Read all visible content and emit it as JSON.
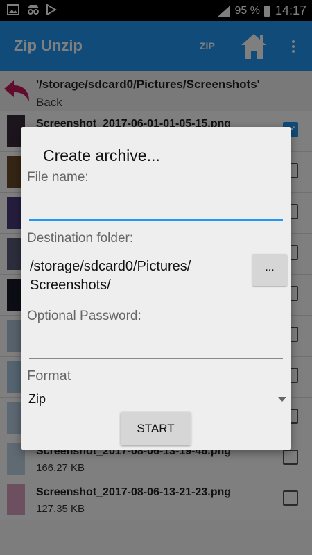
{
  "status_bar": {
    "battery_percent": "95 %",
    "time": "14:17",
    "icons": [
      "image-icon",
      "incognito-icon",
      "play-store-icon",
      "signal-icon",
      "battery-icon"
    ]
  },
  "app_bar": {
    "title": "Zip Unzip",
    "zip_label": "ZIP",
    "icons": [
      "home-icon",
      "more-vert-icon"
    ],
    "color": "#2196f3"
  },
  "path_row": {
    "path": "'/storage/sdcard0/Pictures/Screenshots'",
    "back_label": "Back"
  },
  "files": [
    {
      "name": "Screenshot_2017-06-01-01-05-15.png",
      "size": "",
      "checked": true
    },
    {
      "name": "",
      "size": "",
      "checked": false
    },
    {
      "name": "",
      "size": "",
      "checked": false
    },
    {
      "name": "",
      "size": "",
      "checked": false
    },
    {
      "name": "",
      "size": "",
      "checked": false
    },
    {
      "name": "",
      "size": "",
      "checked": false
    },
    {
      "name": "",
      "size": "",
      "checked": false
    },
    {
      "name": "",
      "size": "",
      "checked": false
    },
    {
      "name": "Screenshot_2017-08-06-13-19-46.png",
      "size": "166.27 KB",
      "checked": false
    },
    {
      "name": "Screenshot_2017-08-06-13-21-23.png",
      "size": "127.35 KB",
      "checked": false
    }
  ],
  "dialog": {
    "title": "Create archive...",
    "file_name_label": "File name:",
    "file_name_value": "",
    "destination_label": "Destination folder:",
    "destination_line1": "/storage/sdcard0/Pictures/",
    "destination_line2": "Screenshots/",
    "browse_button": "...",
    "password_label": "Optional Password:",
    "password_value": "",
    "format_label": "Format",
    "format_value": "Zip",
    "start_button": "START"
  }
}
